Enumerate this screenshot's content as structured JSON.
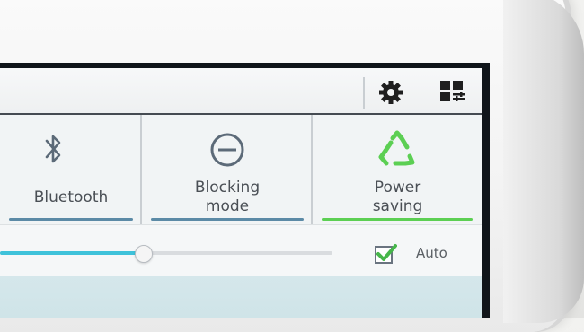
{
  "quick_panel": {
    "toggles": [
      {
        "label": "Bluetooth",
        "state": "off"
      },
      {
        "label": "Blocking\nmode",
        "state": "off"
      },
      {
        "label": "Power\nsaving",
        "state": "on"
      }
    ],
    "brightness": {
      "level": 0.43,
      "auto_checked": true,
      "auto_label": "Auto"
    },
    "icons": {
      "settings": "gear-icon",
      "edit": "grid-edit-icon",
      "bluetooth": "bluetooth-icon",
      "blocking": "minus-circle-icon",
      "power_saving": "recycle-icon"
    }
  },
  "colors": {
    "off_bar": "#5b8aa6",
    "on_bar": "#5ccf53",
    "accent_cyan": "#3fc2da",
    "icon_gray": "#5c6a78"
  }
}
